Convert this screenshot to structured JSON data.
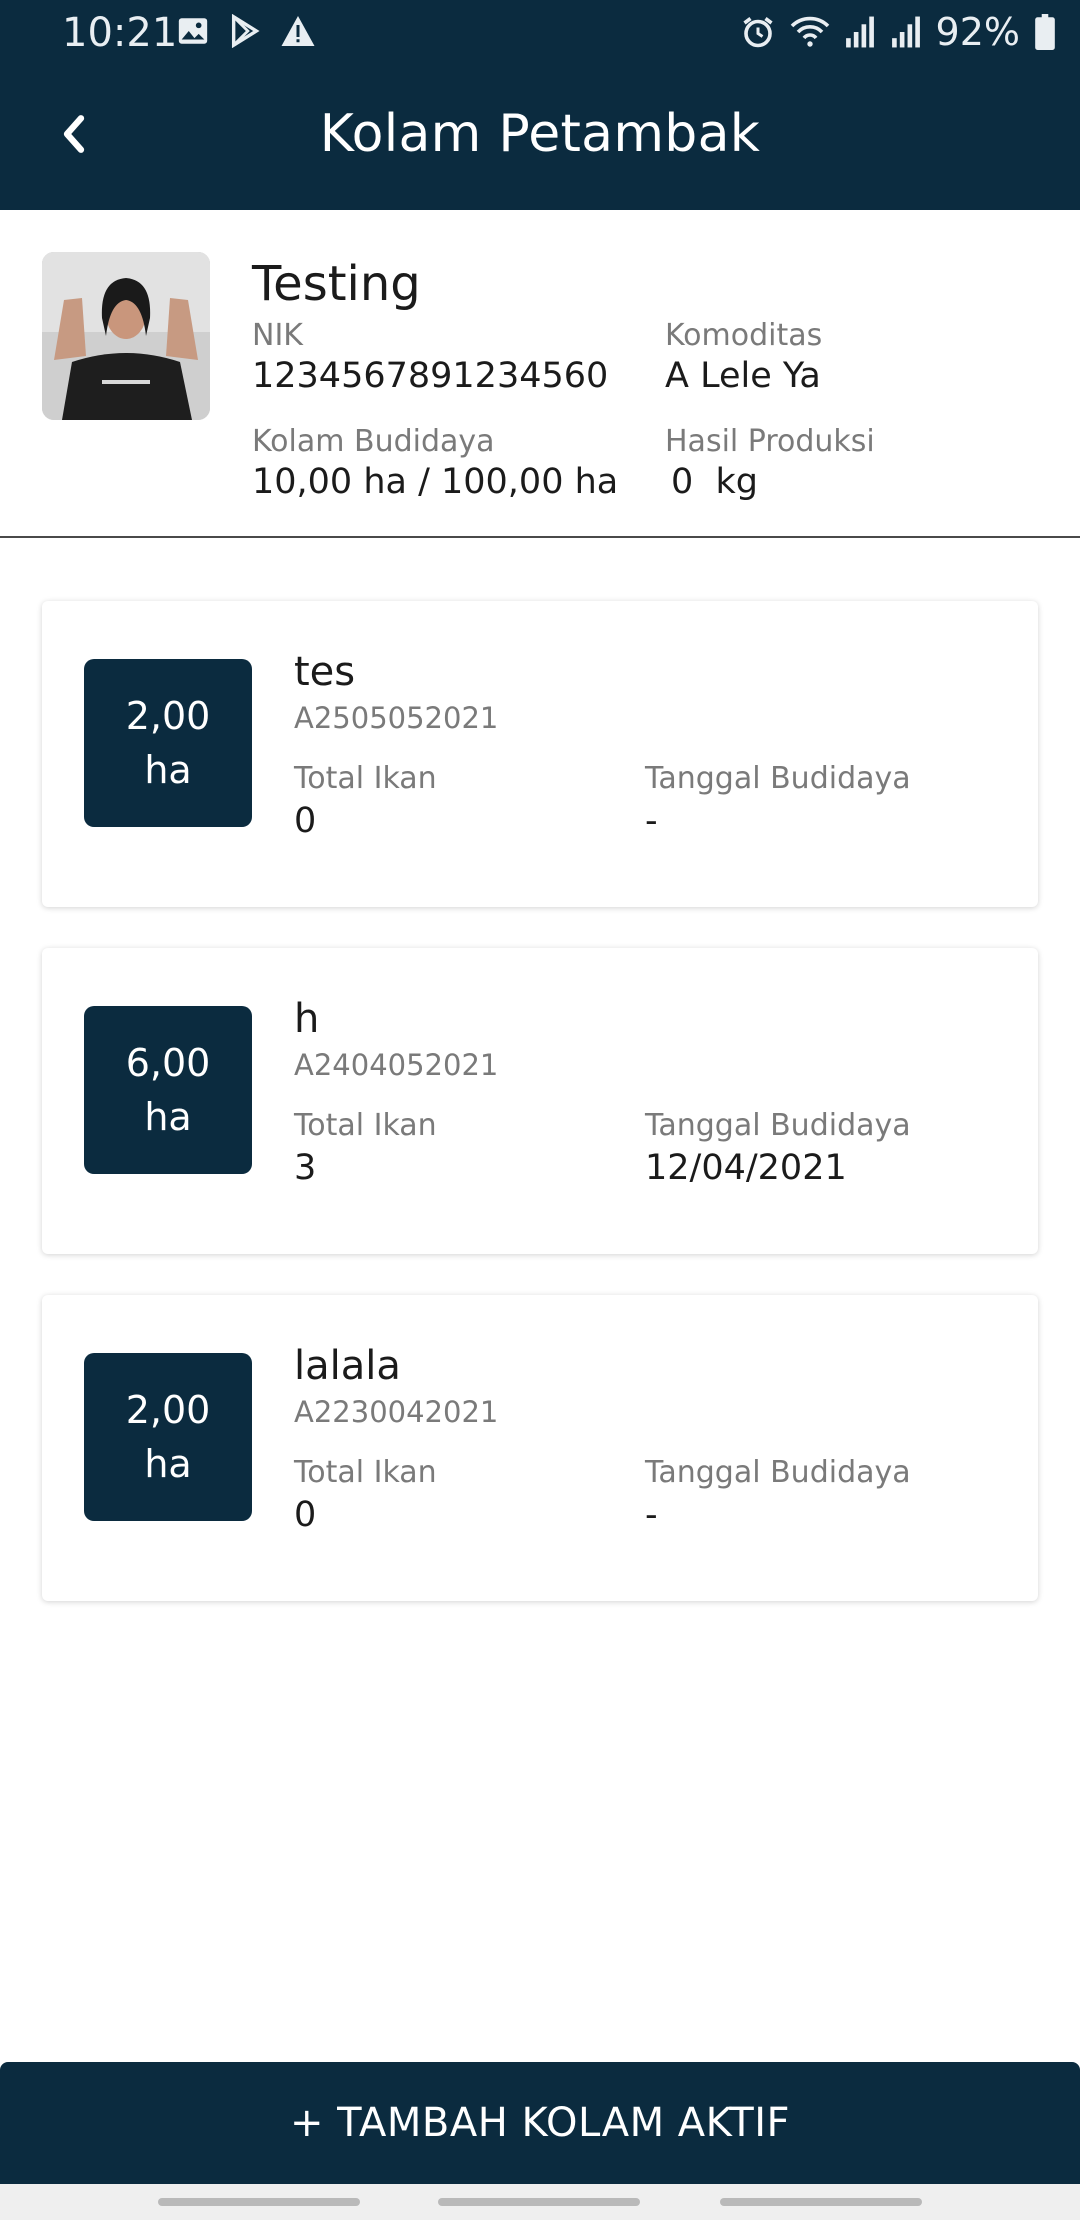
{
  "status_bar": {
    "time": "10:21",
    "battery": "92%",
    "icons_left": [
      "image-icon",
      "play-store-icon",
      "warning-icon"
    ],
    "icons_right": [
      "alarm-icon",
      "wifi-icon",
      "signal-icon",
      "signal-icon",
      "battery-icon"
    ]
  },
  "header": {
    "title": "Kolam Petambak",
    "back_icon": "chevron-left-icon"
  },
  "profile": {
    "name": "Testing",
    "nik_label": "NIK",
    "nik_value": "1234567891234560",
    "komoditas_label": "Komoditas",
    "komoditas_value": "A Lele Ya",
    "kolam_label": "Kolam Budidaya",
    "kolam_value": "10,00 ha / 100,00 ha",
    "hasil_label": "Hasil Produksi",
    "hasil_value": "0  kg"
  },
  "ponds": [
    {
      "area_value": "2,00",
      "area_unit": "ha",
      "name": "tes",
      "code": "A2505052021",
      "total_ikan_label": "Total Ikan",
      "total_ikan_value": "0",
      "tanggal_label": "Tanggal Budidaya",
      "tanggal_value": "-"
    },
    {
      "area_value": "6,00",
      "area_unit": "ha",
      "name": "h",
      "code": "A2404052021",
      "total_ikan_label": "Total Ikan",
      "total_ikan_value": "3",
      "tanggal_label": "Tanggal Budidaya",
      "tanggal_value": "12/04/2021"
    },
    {
      "area_value": "2,00",
      "area_unit": "ha",
      "name": "lalala",
      "code": "A2230042021",
      "total_ikan_label": "Total Ikan",
      "total_ikan_value": "0",
      "tanggal_label": "Tanggal Budidaya",
      "tanggal_value": "-"
    }
  ],
  "actions": {
    "add_pond_label": "+ TAMBAH KOLAM AKTIF"
  },
  "colors": {
    "primary": "#0b2b3f",
    "background": "#ffffff",
    "muted_text": "#7a7a7a"
  }
}
